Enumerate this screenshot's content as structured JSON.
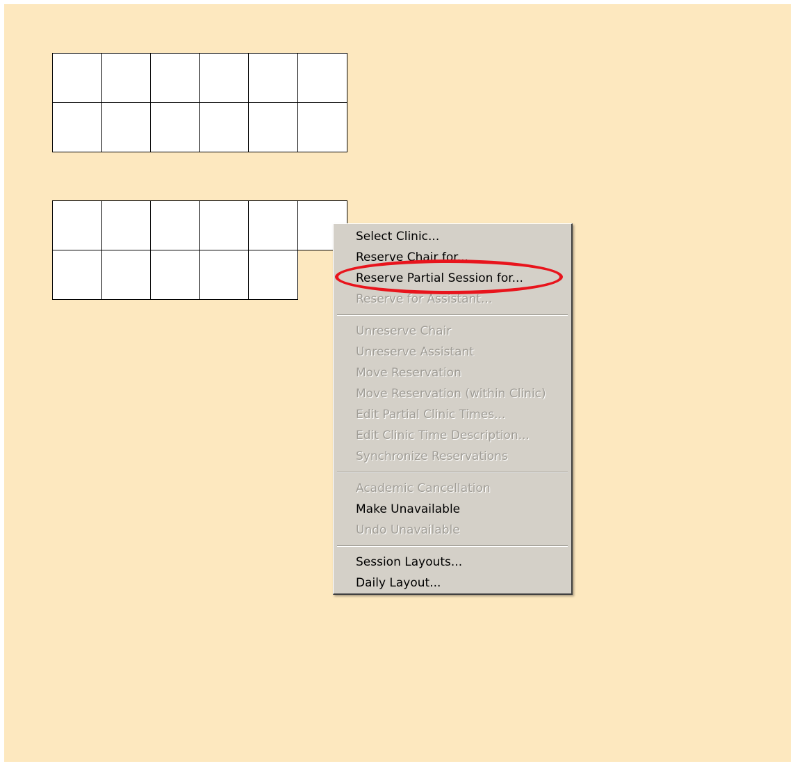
{
  "colors": {
    "background": "#fde8bf",
    "menu_background": "#d4d0c8",
    "disabled_text": "#a09d96",
    "highlight": "#e8141c"
  },
  "grids": [
    {
      "rows": 2,
      "cols": 6,
      "filled_cells_row2": 6
    },
    {
      "rows": 2,
      "cols": 6,
      "filled_cells_row2": 5
    }
  ],
  "menu": {
    "group1": [
      {
        "label": "Select Clinic...",
        "enabled": true
      },
      {
        "label": "Reserve Chair for...",
        "enabled": true
      },
      {
        "label": "Reserve Partial Session for...",
        "enabled": true,
        "highlighted": true
      },
      {
        "label": "Reserve for Assistant...",
        "enabled": false
      }
    ],
    "group2": [
      {
        "label": "Unreserve Chair",
        "enabled": false
      },
      {
        "label": "Unreserve Assistant",
        "enabled": false
      },
      {
        "label": "Move Reservation",
        "enabled": false
      },
      {
        "label": "Move Reservation (within Clinic)",
        "enabled": false
      },
      {
        "label": "Edit Partial Clinic Times...",
        "enabled": false
      },
      {
        "label": "Edit Clinic Time Description...",
        "enabled": false
      },
      {
        "label": "Synchronize Reservations",
        "enabled": false
      }
    ],
    "group3": [
      {
        "label": "Academic Cancellation",
        "enabled": false
      },
      {
        "label": "Make Unavailable",
        "enabled": true
      },
      {
        "label": "Undo Unavailable",
        "enabled": false
      }
    ],
    "group4": [
      {
        "label": "Session Layouts...",
        "enabled": true
      },
      {
        "label": "Daily Layout...",
        "enabled": true
      }
    ]
  }
}
